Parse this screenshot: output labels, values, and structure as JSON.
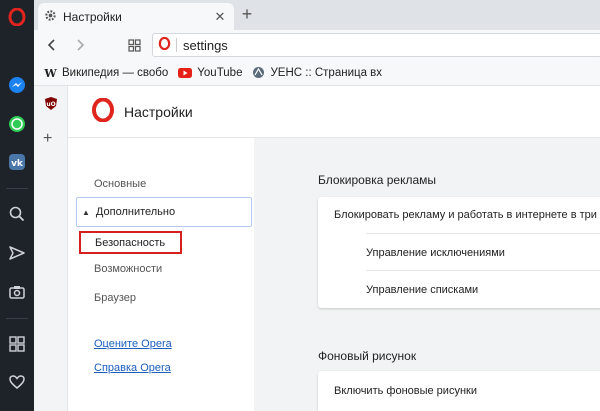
{
  "browser": {
    "tab_title": "Настройки",
    "tab_close": "✕",
    "new_tab": "+",
    "url_value": "settings"
  },
  "bookmarks": [
    {
      "label": "Википедия — свобо",
      "icon": "wikipedia-icon"
    },
    {
      "label": "YouTube",
      "icon": "youtube-icon"
    },
    {
      "label": "УЕНС :: Страница вх",
      "icon": "site-icon"
    }
  ],
  "sidebar": {
    "icons": [
      "opera-logo",
      "messenger-icon",
      "whatsapp-icon",
      "vk-icon",
      "search-icon",
      "send-icon",
      "camera-icon",
      "grid-icon",
      "heart-icon"
    ],
    "rail_add": "+"
  },
  "settings": {
    "header_title": "Настройки",
    "nav": {
      "basic": "Основные",
      "advanced": "Дополнительно",
      "security": "Безопасность",
      "features": "Возможности",
      "browser": "Браузер",
      "rate_link": "Оцените Opera",
      "help_link": "Справка Opera"
    },
    "sections": {
      "adblock_title": "Блокировка рекламы",
      "adblock_toggle": "Блокировать рекламу и работать в интернете в три раза",
      "manage_exceptions": "Управление исключениями",
      "manage_lists": "Управление списками",
      "wallpaper_title": "Фоновый рисунок",
      "wallpaper_toggle": "Включить фоновые рисунки"
    }
  },
  "colors": {
    "opera_red": "#d6201f",
    "link_blue": "#1a5fbf",
    "sidebar_bg": "#1e2229"
  }
}
